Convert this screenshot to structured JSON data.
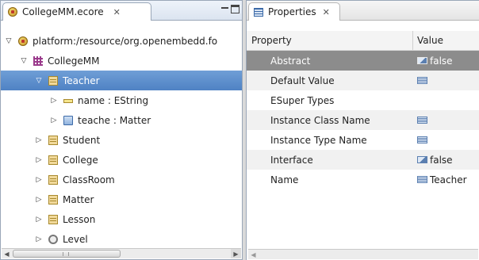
{
  "editor": {
    "tab_title": "CollegeMM.ecore",
    "close_glyph": "✕",
    "tree": [
      {
        "label": "platform:/resource/org.openembedd.fo",
        "icon": "resource-package-icon",
        "expanded": true,
        "level": 0,
        "selected": false
      },
      {
        "label": "CollegeMM",
        "icon": "epackage-icon",
        "expanded": true,
        "level": 1,
        "selected": false
      },
      {
        "label": "Teacher",
        "icon": "eclass-icon",
        "expanded": true,
        "level": 2,
        "selected": true
      },
      {
        "label": "name : EString",
        "icon": "eattribute-icon",
        "expanded": false,
        "level": 3,
        "selected": false
      },
      {
        "label": "teache : Matter",
        "icon": "ereference-icon",
        "expanded": false,
        "level": 3,
        "selected": false
      },
      {
        "label": "Student",
        "icon": "eclass-icon",
        "expanded": false,
        "level": 2,
        "selected": false
      },
      {
        "label": "College",
        "icon": "eclass-icon",
        "expanded": false,
        "level": 2,
        "selected": false
      },
      {
        "label": "ClassRoom",
        "icon": "eclass-icon",
        "expanded": false,
        "level": 2,
        "selected": false
      },
      {
        "label": "Matter",
        "icon": "eclass-icon",
        "expanded": false,
        "level": 2,
        "selected": false
      },
      {
        "label": "Lesson",
        "icon": "eclass-icon",
        "expanded": false,
        "level": 2,
        "selected": false
      },
      {
        "label": "Level",
        "icon": "eenum-icon",
        "expanded": false,
        "level": 2,
        "selected": false
      }
    ],
    "scroll_grip": "|||"
  },
  "properties": {
    "tab_title": "Properties",
    "close_glyph": "✕",
    "columns": {
      "property": "Property",
      "value": "Value"
    },
    "rows": [
      {
        "property": "Abstract",
        "value": "false",
        "value_icon": "checkbox-value-icon",
        "selected": true
      },
      {
        "property": "Default Value",
        "value": "",
        "value_icon": "text-value-icon",
        "selected": false
      },
      {
        "property": "ESuper Types",
        "value": "",
        "value_icon": "",
        "selected": false
      },
      {
        "property": "Instance Class Name",
        "value": "",
        "value_icon": "text-value-icon",
        "selected": false
      },
      {
        "property": "Instance Type Name",
        "value": "",
        "value_icon": "text-value-icon",
        "selected": false
      },
      {
        "property": "Interface",
        "value": "false",
        "value_icon": "checkbox-value-icon",
        "selected": false
      },
      {
        "property": "Name",
        "value": "Teacher",
        "value_icon": "text-value-icon",
        "selected": false
      }
    ]
  },
  "colors": {
    "selection": "#4f82c4",
    "property_selection": "#8c8c8c"
  }
}
